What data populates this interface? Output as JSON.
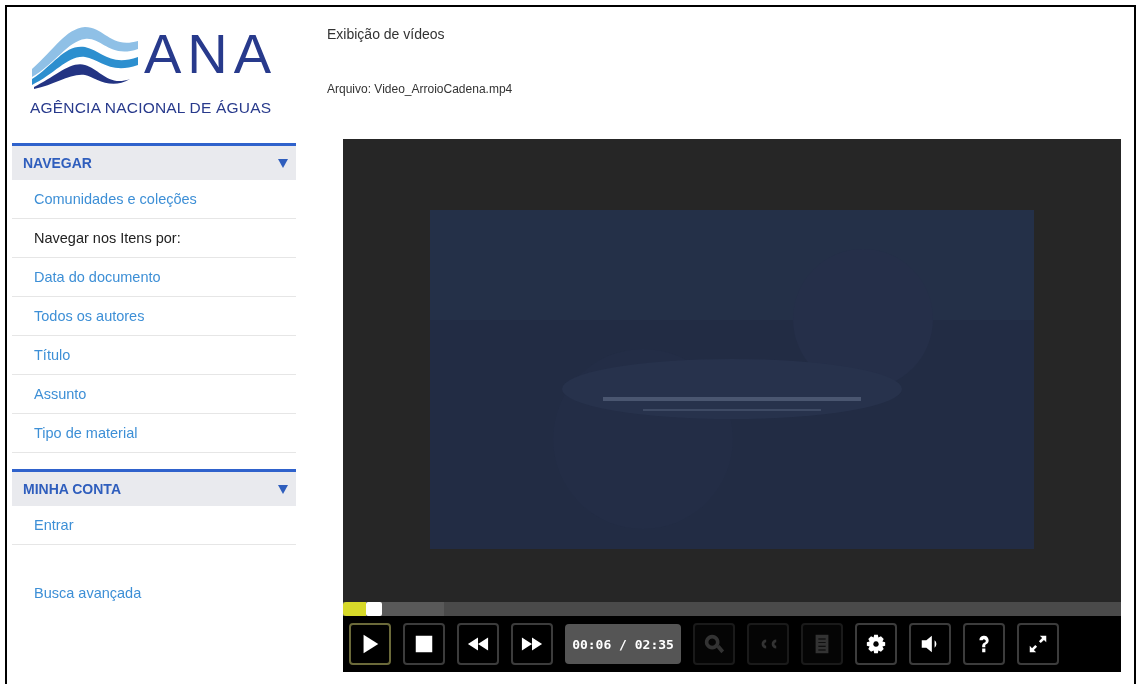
{
  "logo": {
    "name": "ANA",
    "subtitle": "AGÊNCIA NACIONAL DE ÁGUAS"
  },
  "sections": [
    {
      "title": "NAVEGAR",
      "expanded": true,
      "items": [
        {
          "label": "Comunidades e coleções",
          "kind": "link"
        },
        {
          "label": "Navegar nos Itens por:",
          "kind": "label"
        },
        {
          "label": "Data do documento",
          "kind": "link"
        },
        {
          "label": "Todos os autores",
          "kind": "link"
        },
        {
          "label": "Título",
          "kind": "link"
        },
        {
          "label": "Assunto",
          "kind": "link"
        },
        {
          "label": "Tipo de material",
          "kind": "link"
        }
      ]
    },
    {
      "title": "MINHA CONTA",
      "expanded": true,
      "items": [
        {
          "label": "Entrar",
          "kind": "link"
        }
      ]
    }
  ],
  "advanced_search": "Busca avançada",
  "page_title": "Exibição de vídeos",
  "file_label": "Arquivo: Video_ArroioCadena.mp4",
  "player": {
    "progress": {
      "level": 0.03
    },
    "buffer": {
      "level": 0.13
    },
    "time": "00:06 / 02:35",
    "buttons": [
      {
        "kind": "play",
        "disabled": false,
        "selected": true
      },
      {
        "kind": "stop",
        "disabled": false,
        "selected": false
      },
      {
        "kind": "rewind",
        "disabled": false,
        "selected": false
      },
      {
        "kind": "forward",
        "disabled": false,
        "selected": false
      },
      {
        "kind": "time"
      },
      {
        "kind": "search",
        "disabled": true,
        "selected": false
      },
      {
        "kind": "captions",
        "disabled": true,
        "selected": false
      },
      {
        "kind": "transcript",
        "disabled": true,
        "selected": false
      },
      {
        "kind": "settings",
        "disabled": false,
        "selected": false
      },
      {
        "kind": "volume",
        "disabled": false,
        "selected": false
      },
      {
        "kind": "help",
        "disabled": false,
        "selected": false
      },
      {
        "kind": "fullscreen",
        "disabled": false,
        "selected": false
      }
    ]
  }
}
